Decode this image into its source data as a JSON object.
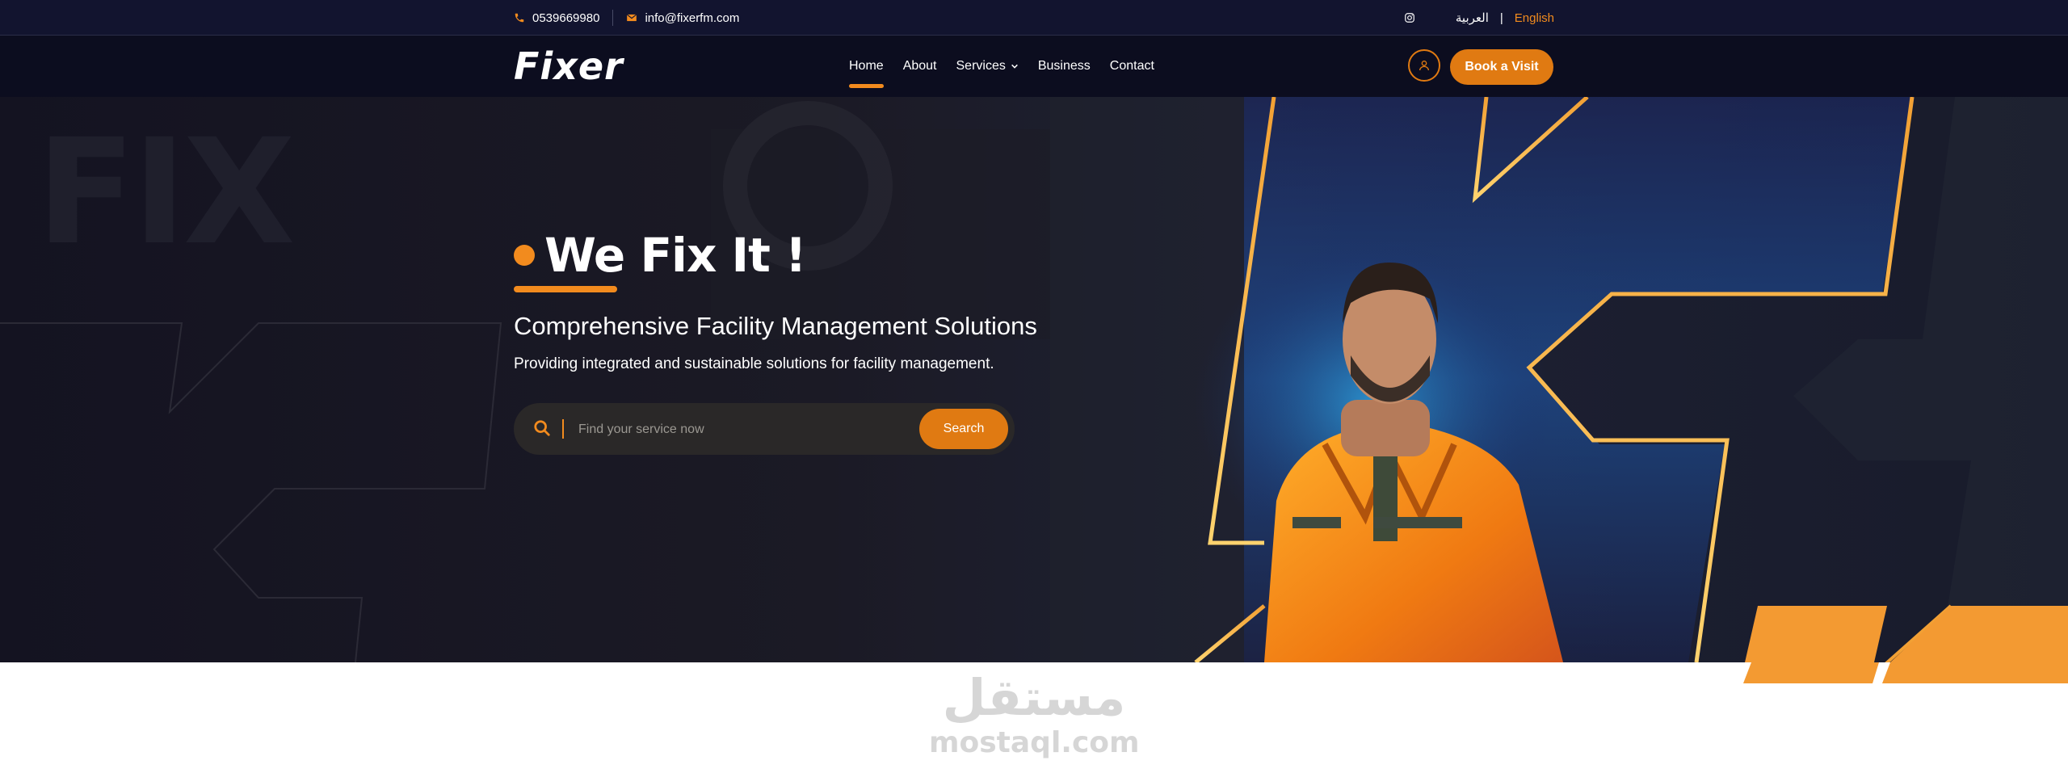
{
  "topbar": {
    "phone": "0539669980",
    "email": "info@fixerfm.com",
    "lang_ar": "العربية",
    "lang_sep": "|",
    "lang_en": "English",
    "icons": [
      "phone-icon",
      "mail-icon",
      "instagram-icon"
    ]
  },
  "navbar": {
    "logo": "Fixer",
    "items": [
      {
        "label": "Home",
        "active": true
      },
      {
        "label": "About"
      },
      {
        "label": "Services"
      },
      {
        "label": "Business"
      },
      {
        "label": "Contact"
      }
    ],
    "book_label": "Book a Visit"
  },
  "hero": {
    "watermark": "FIX",
    "title": "We Fix It !",
    "subtitle": "Comprehensive Facility Management Solutions",
    "description": "Providing integrated and sustainable solutions for facility management.",
    "search_placeholder": "Find your service now",
    "search_button": "Search"
  },
  "watermark_logo": {
    "arabic": "مستقل",
    "latin": "mostaql.com"
  },
  "colors": {
    "accent": "#f28b1e",
    "accent_dark": "#e07a12",
    "navy": "#12142f",
    "nav_bg": "#0c0d1f"
  }
}
